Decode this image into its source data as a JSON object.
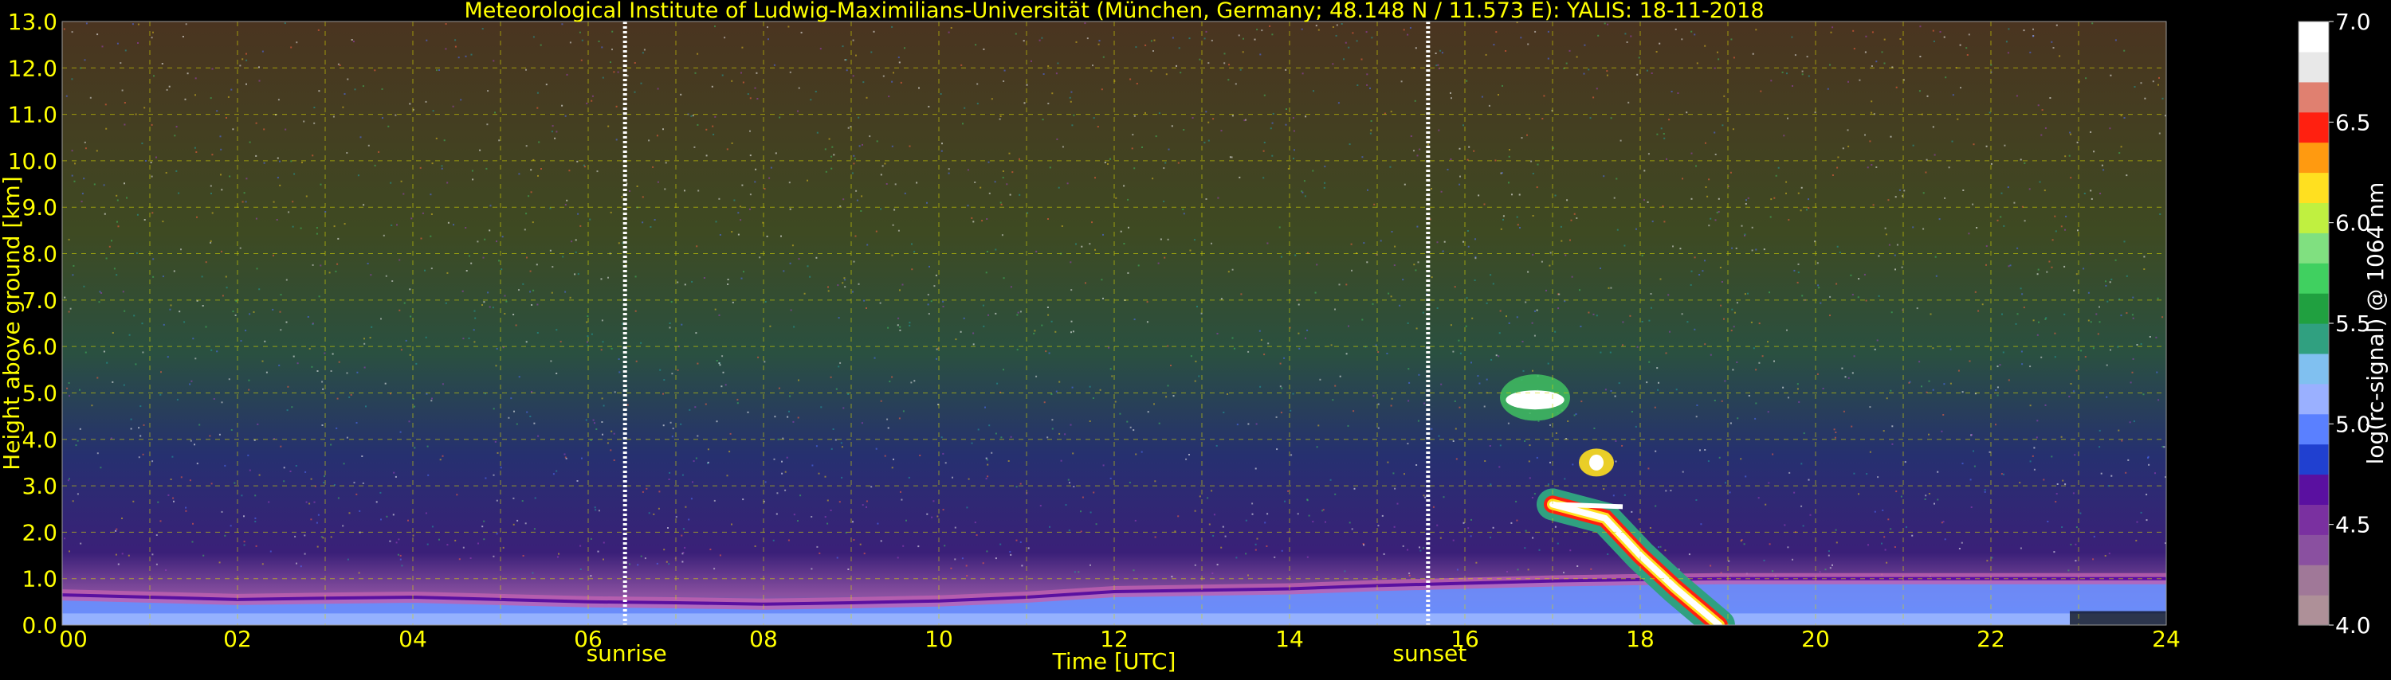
{
  "chart_data": {
    "type": "heatmap",
    "title": "Meteorological Institute of Ludwig-Maximilians-Universität (München, Germany; 48.148 N / 11.573 E):    YALIS: 18-11-2018",
    "xlabel": "Time [UTC]",
    "ylabel": "Height above ground [km]",
    "xlim": [
      0,
      24
    ],
    "ylim": [
      0,
      13
    ],
    "x_ticks": [
      "00",
      "02",
      "04",
      "06",
      "08",
      "10",
      "12",
      "14",
      "16",
      "18",
      "20",
      "22",
      "24"
    ],
    "y_ticks": [
      "0.0",
      "1.0",
      "2.0",
      "3.0",
      "4.0",
      "5.0",
      "6.0",
      "7.0",
      "8.0",
      "9.0",
      "10.0",
      "11.0",
      "12.0",
      "13.0"
    ],
    "grid": true,
    "annotations": [
      {
        "label": "sunrise",
        "x": 6.42
      },
      {
        "label": "sunset",
        "x": 15.58
      }
    ],
    "boundary_layer_top_km": [
      [
        0,
        0.65
      ],
      [
        1,
        0.6
      ],
      [
        2,
        0.55
      ],
      [
        3,
        0.58
      ],
      [
        4,
        0.6
      ],
      [
        5,
        0.55
      ],
      [
        6,
        0.5
      ],
      [
        7,
        0.48
      ],
      [
        8,
        0.45
      ],
      [
        9,
        0.48
      ],
      [
        10,
        0.52
      ],
      [
        11,
        0.6
      ],
      [
        12,
        0.72
      ],
      [
        13,
        0.75
      ],
      [
        14,
        0.78
      ],
      [
        15,
        0.85
      ],
      [
        16,
        0.9
      ],
      [
        17,
        0.95
      ],
      [
        18,
        0.98
      ],
      [
        19,
        1.0
      ],
      [
        20,
        1.0
      ],
      [
        21,
        1.0
      ],
      [
        22,
        1.0
      ],
      [
        23,
        1.0
      ],
      [
        24,
        1.0
      ]
    ],
    "cloud_features": [
      {
        "x": [
          16.4,
          17.2
        ],
        "y": [
          4.4,
          5.4
        ]
      },
      {
        "x": [
          17.3,
          17.7
        ],
        "y": [
          3.2,
          3.8
        ]
      },
      {
        "x": [
          17.0,
          18.9
        ],
        "y": [
          0.0,
          2.8
        ]
      }
    ],
    "colorbar": {
      "label": "log(rc-signal) @ 1064 nm",
      "range": [
        4.0,
        7.0
      ],
      "ticks": [
        "4.0",
        "4.5",
        "5.0",
        "5.5",
        "6.0",
        "6.5",
        "7.0"
      ]
    },
    "colors": {
      "accent": "#ffff00",
      "background": "#000000",
      "text_white": "#ffffff",
      "colormap": [
        "#ae9098",
        "#a07898",
        "#8a50a0",
        "#7a30a0",
        "#5a10a0",
        "#2040d0",
        "#5a80ff",
        "#9ab0ff",
        "#80c0f0",
        "#30a080",
        "#20a040",
        "#40d060",
        "#80e080",
        "#c0f040",
        "#ffe020",
        "#ff9a10",
        "#ff2010",
        "#e08070",
        "#e8e8e8",
        "#ffffff"
      ]
    }
  }
}
